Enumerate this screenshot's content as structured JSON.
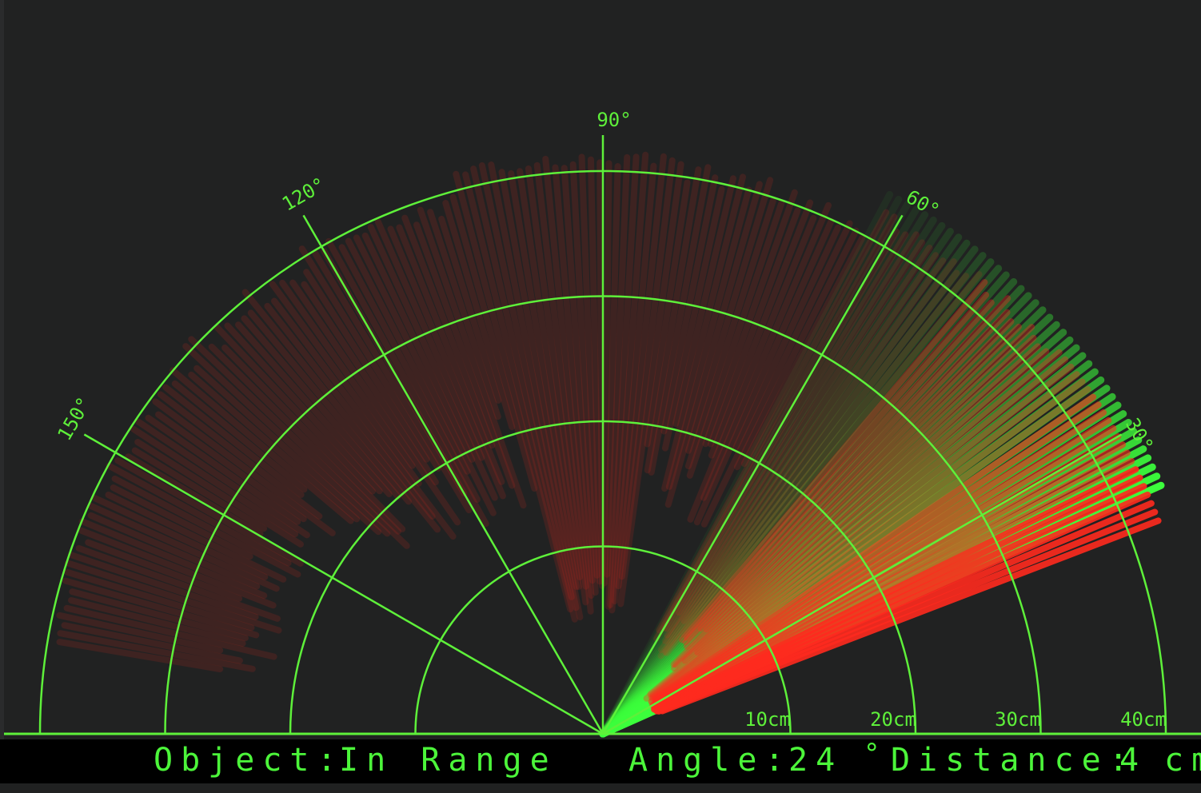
{
  "radar": {
    "angle_labels": [
      "30°",
      "60°",
      "90°",
      "120°",
      "150°"
    ],
    "distance_labels": [
      "10cm",
      "20cm",
      "30cm",
      "40cm"
    ],
    "colors": {
      "grid": "#5ef03a",
      "sweep": "#3cff3c",
      "object": "#ff2a1e",
      "background": "#212222",
      "status_text": "#4cf53a"
    }
  },
  "status": {
    "object_label": "Object:",
    "object_value": "In Range",
    "angle_label": "Angle:",
    "angle_value": "24",
    "angle_unit": "°",
    "distance_label": "Distance:",
    "distance_value": "4",
    "distance_unit": "cm"
  }
}
